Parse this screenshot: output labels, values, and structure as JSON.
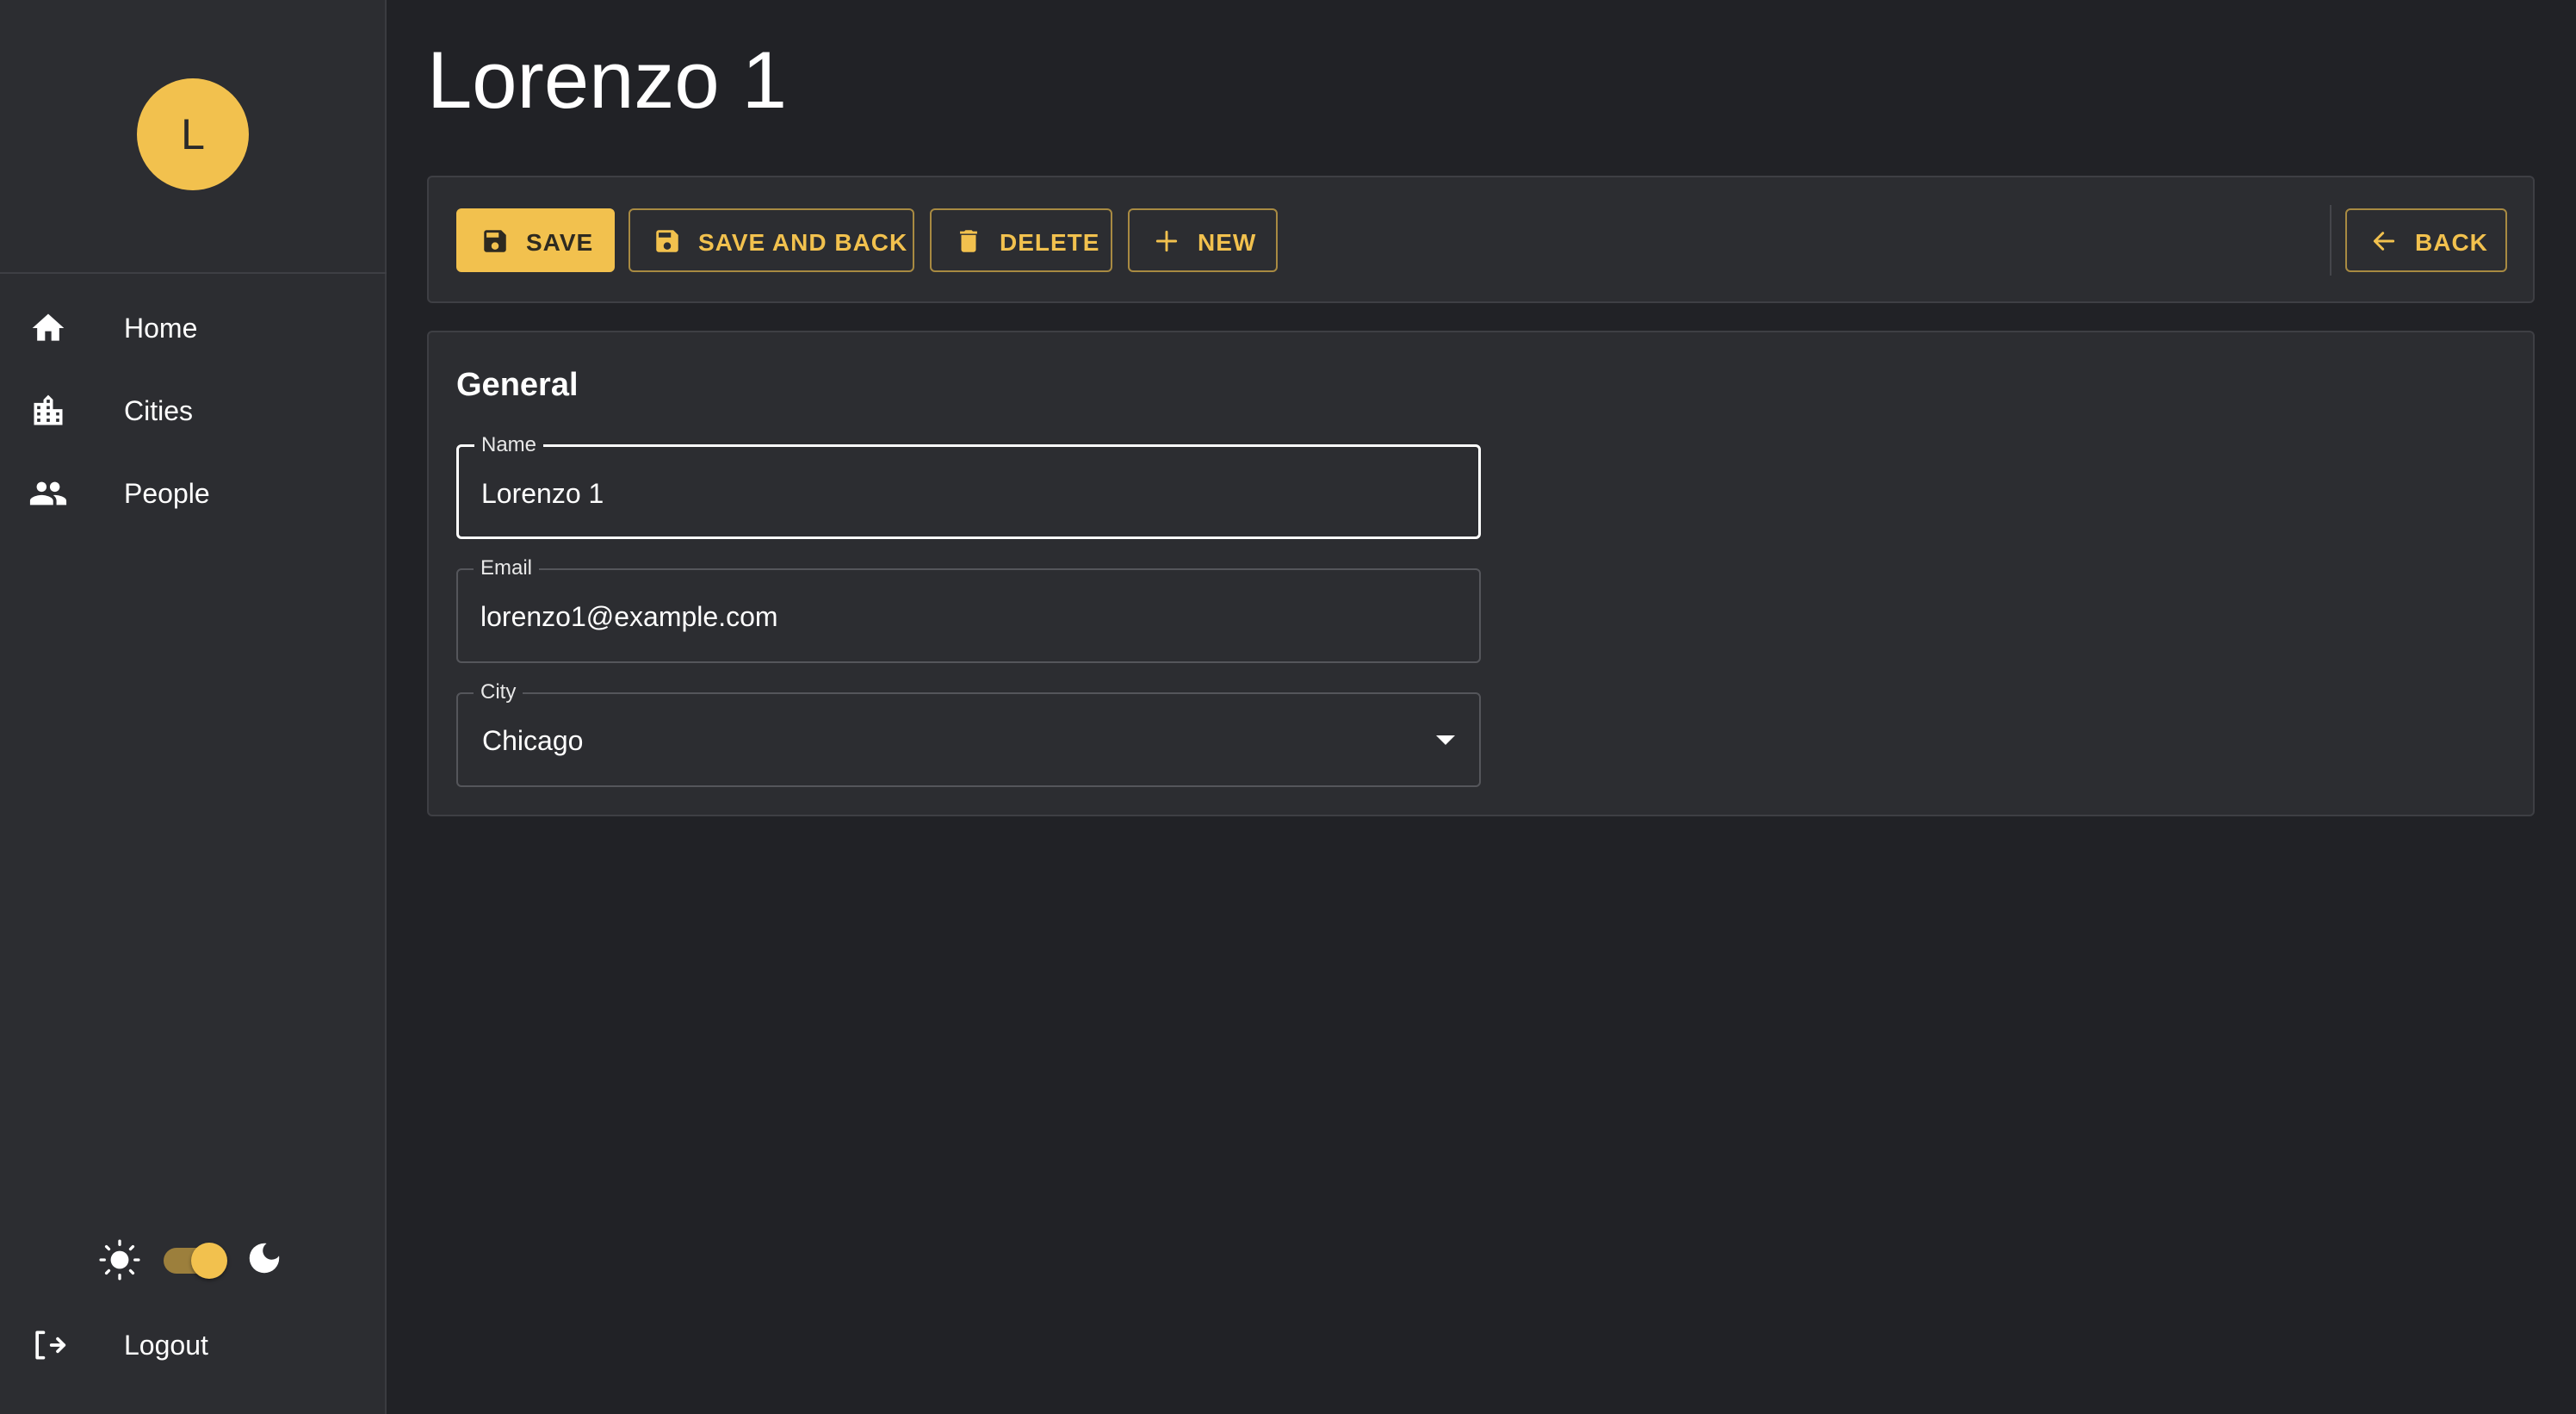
{
  "app": {
    "avatar_letter": "L",
    "accent_color": "#f2c14e",
    "theme": "dark"
  },
  "sidebar": {
    "items": [
      {
        "label": "Home",
        "icon": "home-icon"
      },
      {
        "label": "Cities",
        "icon": "city-icon"
      },
      {
        "label": "People",
        "icon": "people-icon"
      }
    ],
    "logout_label": "Logout",
    "theme_toggle": {
      "dark_mode_on": true
    }
  },
  "page": {
    "title": "Lorenzo 1"
  },
  "toolbar": {
    "save_label": "SAVE",
    "save_and_back_label": "SAVE AND BACK",
    "delete_label": "DELETE",
    "new_label": "NEW",
    "back_label": "BACK"
  },
  "form": {
    "section_title": "General",
    "name": {
      "label": "Name",
      "value": "Lorenzo 1"
    },
    "email": {
      "label": "Email",
      "value": "lorenzo1@example.com"
    },
    "city": {
      "label": "City",
      "value": "Chicago"
    }
  }
}
